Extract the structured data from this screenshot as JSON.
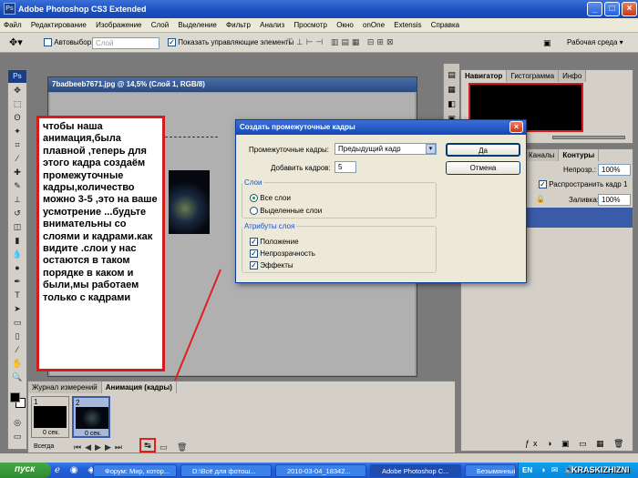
{
  "app": {
    "title": "Adobe Photoshop CS3 Extended",
    "logo": "Ps"
  },
  "window_controls": {
    "minimize": "_",
    "maximize": "□",
    "close": "×"
  },
  "menu": [
    "Файл",
    "Редактирование",
    "Изображение",
    "Слой",
    "Выделение",
    "Фильтр",
    "Анализ",
    "Просмотр",
    "Окно",
    "onOne",
    "Extensis",
    "Справка"
  ],
  "options": {
    "autoselect_label": "Автовыбор:",
    "autoselect_value": "Слой",
    "show_controls_label": "Показать управляющие элементы",
    "workspace_label": "Рабочая среда ▾"
  },
  "document": {
    "title": "7badbeeb7671.jpg @ 14,5% (Слой 1, RGB/8)"
  },
  "callout": {
    "text": "чтобы наша анимация,была плавной ,теперь для этого кадра создаём промежуточные кадры,количество можно 3-5 ,это на ваше усмотрение ...будьте внимательны со слоями и кадрами.как видите .слои у нас остаются в таком порядке в каком и были,мы работаем только с кадрами"
  },
  "dialog": {
    "title": "Создать промежуточные кадры",
    "tween_with_label": "Промежуточные кадры:",
    "tween_with_value": "Предыдущий кадр",
    "frames_to_add_label": "Добавить кадров:",
    "frames_to_add_value": "5",
    "ok_label": "Да",
    "cancel_label": "Отмена",
    "layers_group": "Слои",
    "all_layers": "Все слои",
    "selected_layers": "Выделенные слои",
    "params_group": "Атрибуты слоя",
    "position": "Положение",
    "opacity": "Непрозрачность",
    "effects": "Эффекты"
  },
  "navigator": {
    "tabs": [
      "Навигатор",
      "Гистограмма",
      "Инфо"
    ]
  },
  "layers": {
    "tabs": [
      "Каналы",
      "Контуры"
    ],
    "opacity_label": "Непрозр.:",
    "opacity_value": "100%",
    "unify_label": "Распространить кадр 1",
    "fill_label": "Заливка:",
    "fill_value": "100%"
  },
  "animation": {
    "tabs": [
      "Журнал измерений",
      "Анимация (кадры)"
    ],
    "frames": [
      {
        "number": "1",
        "delay": "0 сек."
      },
      {
        "number": "2",
        "delay": "0 сек."
      }
    ],
    "loop_label": "Всегда"
  },
  "taskbar": {
    "start_label": "пуск",
    "items": [
      "Форум: Мир, котор...",
      "D:\\Всё для фотош...",
      "2010-03-04_18342...",
      "Adobe Photoshop C...",
      "Безымянный - Paint"
    ],
    "lang": "EN",
    "watermark": "KRASKIZHIZNI"
  },
  "colors": {
    "accent": "#245edb",
    "callout_border": "#d41c1c",
    "dialog_title": "#1648b4"
  }
}
